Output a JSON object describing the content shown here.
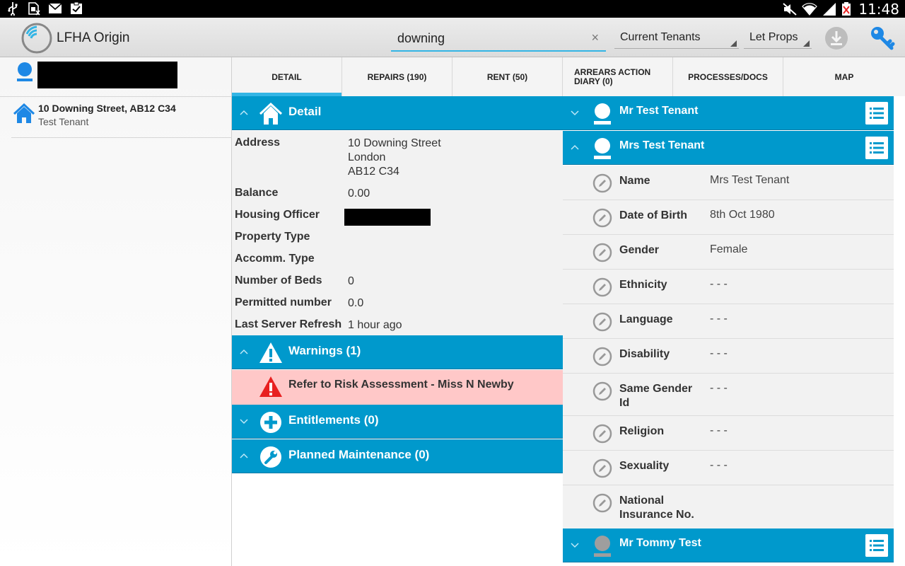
{
  "status_bar": {
    "time": "11:48"
  },
  "app": {
    "title": "LFHA Origin"
  },
  "search": {
    "value": "downing",
    "clear_glyph": "×"
  },
  "filters": {
    "tenant_filter": "Current Tenants",
    "property_filter": "Let Props"
  },
  "left_pane": {
    "results": [
      {
        "address": "10 Downing Street, AB12 C34",
        "tenant": "Test Tenant"
      }
    ]
  },
  "tabs": [
    {
      "label": "DETAIL",
      "active": true
    },
    {
      "label": "REPAIRS (190)"
    },
    {
      "label": "RENT (50)"
    },
    {
      "label": "ARREARS ACTION DIARY (0)"
    },
    {
      "label": "PROCESSES/DOCS"
    },
    {
      "label": "MAP"
    }
  ],
  "detail": {
    "header": "Detail",
    "rows": {
      "address": {
        "label": "Address",
        "line1": "10 Downing Street",
        "line2": "London",
        "line3": "AB12 C34"
      },
      "balance": {
        "label": "Balance",
        "value": "0.00"
      },
      "housing_officer": {
        "label": "Housing Officer"
      },
      "property_type": {
        "label": "Property Type",
        "value": ""
      },
      "accomm_type": {
        "label": "Accomm. Type",
        "value": ""
      },
      "beds": {
        "label": "Number of Beds",
        "value": "0"
      },
      "permitted": {
        "label": "Permitted number",
        "value": "0.0"
      },
      "refresh": {
        "label": "Last Server Refresh",
        "value": "1 hour ago"
      }
    }
  },
  "warnings": {
    "header": "Warnings (1)",
    "items": [
      "Refer to Risk Assessment - Miss N Newby"
    ]
  },
  "entitlements": {
    "header": "Entitlements (0)"
  },
  "planned_maintenance": {
    "header": "Planned Maintenance (0)"
  },
  "tenants": [
    {
      "name": "Mr Test Tenant",
      "expanded": false
    },
    {
      "name": "Mrs Test Tenant",
      "expanded": true,
      "fields": [
        {
          "label": "Name",
          "value": "Mrs Test Tenant"
        },
        {
          "label": "Date of Birth",
          "value": "8th Oct 1980"
        },
        {
          "label": "Gender",
          "value": "Female"
        },
        {
          "label": "Ethnicity",
          "value": "- - -"
        },
        {
          "label": "Language",
          "value": "- - -"
        },
        {
          "label": "Disability",
          "value": "- - -"
        },
        {
          "label": "Same Gender Id",
          "value": "- - -"
        },
        {
          "label": "Religion",
          "value": "- - -"
        },
        {
          "label": "Sexuality",
          "value": "- - -"
        },
        {
          "label": "National Insurance No.",
          "value": ""
        }
      ]
    },
    {
      "name": "Mr Tommy Test",
      "expanded": false
    }
  ],
  "colors": {
    "accent": "#0099cc",
    "highlight": "#33b5e5",
    "warning_bg": "#ffc8c8",
    "warning_icon": "#e82020"
  }
}
